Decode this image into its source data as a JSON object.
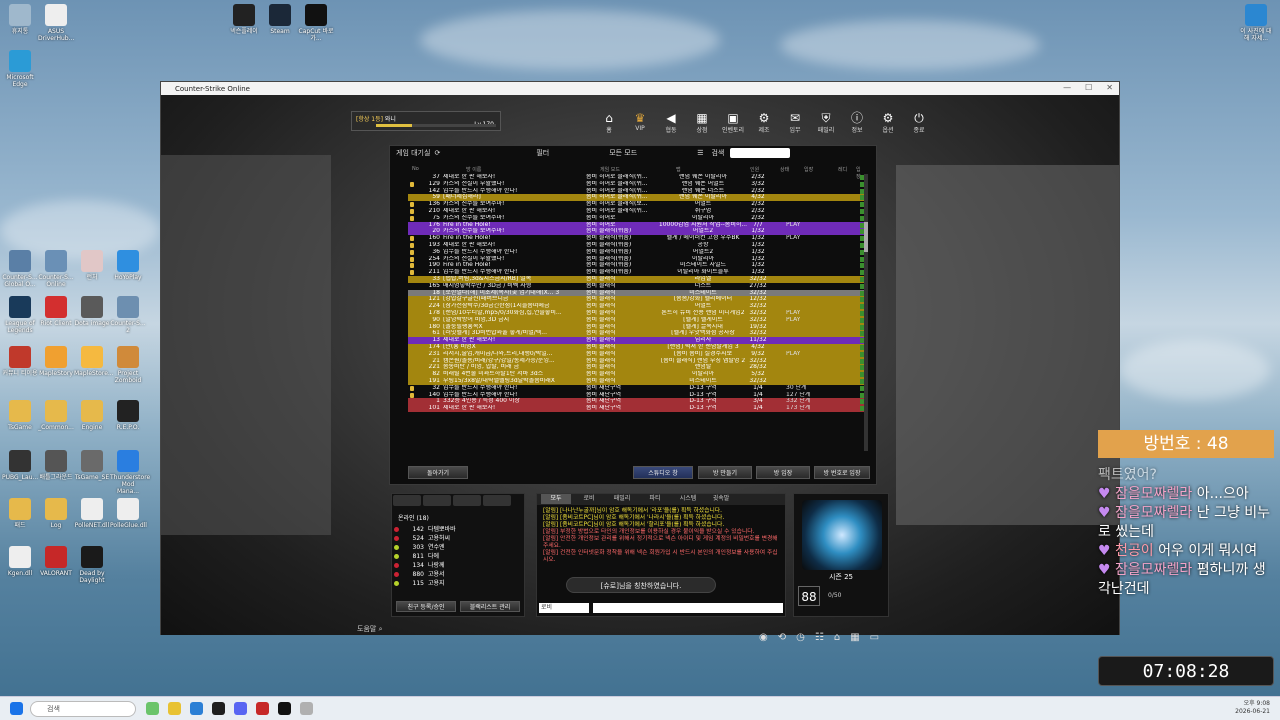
{
  "desktop": {
    "icons": [
      {
        "label": "휴지통"
      },
      {
        "label": "ASUS DriverHub..."
      },
      {
        "label": "Microsoft Edge"
      },
      {
        "label": "넥슨플레이"
      },
      {
        "label": "Steam"
      },
      {
        "label": "CapCut 바로가..."
      },
      {
        "label": "Counter-S... Global O..."
      },
      {
        "label": "Counter-S... Online"
      },
      {
        "label": "런처"
      },
      {
        "label": "HoYoPlay"
      },
      {
        "label": "League of Legends"
      },
      {
        "label": "Riot Client"
      },
      {
        "label": "Dota image"
      },
      {
        "label": "Counter-S... 2"
      },
      {
        "label": "커뮤니 티이용"
      },
      {
        "label": "MapleStory"
      },
      {
        "label": "MapleStore..."
      },
      {
        "label": "Project Zomboid"
      },
      {
        "label": "TsGame"
      },
      {
        "label": "_Common..."
      },
      {
        "label": "Engine"
      },
      {
        "label": "R.E.P.O."
      },
      {
        "label": "PUBG_Lau..."
      },
      {
        "label": "배틀그라운드"
      },
      {
        "label": "TsGame_SE"
      },
      {
        "label": "Thunderstore Mod Mana..."
      },
      {
        "label": "패드"
      },
      {
        "label": "Log"
      },
      {
        "label": "PolleNET.dll"
      },
      {
        "label": "PolleGlue.dll"
      },
      {
        "label": "Kgen.dll"
      },
      {
        "label": "VALORANT"
      },
      {
        "label": "Dead by Daylight"
      },
      {
        "label": "이 사진에 대해 자세..."
      }
    ]
  },
  "window": {
    "title": "Counter-Strike Online"
  },
  "profile": {
    "rank": "[항상 1등]",
    "name": "와니",
    "level": "Lv.170",
    "badge": "150"
  },
  "nav": [
    {
      "label": "홈",
      "icon": "home-icon"
    },
    {
      "label": "VIP",
      "icon": "crown-icon"
    },
    {
      "label": "협동",
      "icon": "megaphone-icon"
    },
    {
      "label": "상점",
      "icon": "shop-icon"
    },
    {
      "label": "인벤토리",
      "icon": "inventory-icon"
    },
    {
      "label": "제조",
      "icon": "craft-icon"
    },
    {
      "label": "임무",
      "icon": "mission-icon"
    },
    {
      "label": "패밀리",
      "icon": "family-icon"
    },
    {
      "label": "정보",
      "icon": "info-icon"
    },
    {
      "label": "옵션",
      "icon": "gear-icon"
    },
    {
      "label": "종료",
      "icon": "power-icon"
    }
  ],
  "room_list": {
    "header": "게임 대기실",
    "filter_label": "필터",
    "mode_label": "모든 모드",
    "search_label": "검색",
    "columns": [
      "No",
      "방 이름",
      "게임 모드",
      "맵",
      "인원",
      "상태",
      "입장",
      "레디",
      "입장"
    ],
    "rows": [
      {
        "no": "37",
        "title": "제대로 한 판 해보자!",
        "mode": "좀비 히어로 클래식(쉬...",
        "map": "랜덤 웨폰 이탈리아",
        "count": "2/32",
        "status": "",
        "style": "",
        "lock": false
      },
      {
        "no": "129",
        "title": "카스의 전설이 부활했다!",
        "mode": "좀비 히어로 클래식(쉬...",
        "map": "랜덤 웨폰 어벌트",
        "count": "3/32",
        "status": "",
        "style": "",
        "lock": true
      },
      {
        "no": "142",
        "title": "임무를 반드시 수행해야 한다!",
        "mode": "좀비 히어로 클래식(쉬...",
        "map": "랜덤 웨폰 더스트",
        "count": "2/32",
        "status": "",
        "style": "",
        "lock": false
      },
      {
        "no": "59",
        "title": "[패너제집해라]",
        "mode": "좀비 히어로 클래식(쉬...",
        "map": "랜덤 웨폰 이탈리아",
        "count": "4/32",
        "status": "",
        "style": "gold",
        "lock": false
      },
      {
        "no": "136",
        "title": "카스의 진수를 보여주마!",
        "mode": "좀비 히어로 클래식(보...",
        "map": "어벌트",
        "count": "2/32",
        "status": "",
        "style": "",
        "lock": true
      },
      {
        "no": "210",
        "title": "제대로 한 판 해보자!",
        "mode": "좀비 히어로 클래식(쉬...",
        "map": "쥐구멍",
        "count": "2/32",
        "status": "",
        "style": "",
        "lock": true
      },
      {
        "no": "75",
        "title": "카스의 진수를 보여주마!",
        "mode": "좀비 히어로",
        "map": "이탈리아",
        "count": "2/32",
        "status": "",
        "style": "",
        "lock": true
      },
      {
        "no": "176",
        "title": "Fire in the Hole!",
        "mode": "좀비 히어로",
        "map": "10000감염 지원처 작업--좀비히...",
        "count": "7/7",
        "status": "PLAY",
        "style": "purple",
        "lock": false
      },
      {
        "no": "20",
        "title": "카스의 진수를 보여주마!",
        "mode": "좀비 클래식(쉬움)",
        "map": "어벌트2",
        "count": "1/32",
        "status": "",
        "style": "purple",
        "lock": false
      },
      {
        "no": "160",
        "title": "Fire in the Hole!",
        "mode": "좀비 클래식(쉬움)",
        "map": "헬게 / 메이러컨 고정 우주BK",
        "count": "1/32",
        "status": "PLAY",
        "style": "",
        "lock": true
      },
      {
        "no": "193",
        "title": "제대로 한 판 해보자!",
        "mode": "좀비 클래식(쉬움)",
        "map": "공항",
        "count": "1/32",
        "status": "",
        "style": "",
        "lock": true
      },
      {
        "no": "36",
        "title": "임무를 반드시 수행해야 한다!",
        "mode": "좀비 클래식(쉬움)",
        "map": "어벌트2",
        "count": "1/32",
        "status": "",
        "style": "",
        "lock": true
      },
      {
        "no": "254",
        "title": "카스의 전설이 부활했다!",
        "mode": "좀비 클래식(쉬움)",
        "map": "이탈리아",
        "count": "1/32",
        "status": "",
        "style": "",
        "lock": true
      },
      {
        "no": "190",
        "title": "Fire in the Hole!",
        "mode": "좀비 클래식(쉬움)",
        "map": "미스테이트 자일드",
        "count": "1/32",
        "status": "",
        "style": "",
        "lock": true
      },
      {
        "no": "211",
        "title": "임무를 반드시 수행해야 한다!",
        "mode": "좀비 클래식(쉬움)",
        "map": "이탈리아 화이트블루",
        "count": "1/32",
        "status": "",
        "style": "",
        "lock": true
      },
      {
        "no": "33",
        "title": "[랩탑,버림,3d&치즈금지/RB] 일목",
        "mode": "좀비 클래식",
        "map": "라임엘",
        "count": "32/32",
        "status": "",
        "style": "gold",
        "lock": false
      },
      {
        "no": "165",
        "title": "매시멍넣박수만 / 3D금 / 비벡 사형",
        "mode": "좀비 클래식",
        "map": "더스트",
        "count": "27/32",
        "status": "",
        "style": "",
        "lock": false
      },
      {
        "no": "18",
        "title": "[로한멀타(해] 미초제(목사(곶 업기대해(X... 3",
        "mode": "좀비 클래식",
        "map": "미스테이트",
        "count": "32/32",
        "status": "",
        "style": "grey",
        "lock": false
      },
      {
        "no": "121",
        "title": "[강밥갈구글신(패버브디금",
        "mode": "좀비 클래식",
        "map": "[좀좀/강화] 헬리베이터",
        "count": "12/32",
        "status": "",
        "style": "gold",
        "lock": false
      },
      {
        "no": "224",
        "title": "[참가전참박수/3d금긴한점(1지늘좀떠메금",
        "mode": "좀비 클래식",
        "map": "어벌트",
        "count": "32/32",
        "status": "",
        "style": "gold",
        "lock": false
      },
      {
        "no": "178",
        "title": "[랜덤/10무티발,mp5/0/30화섬,섭,연솔좋비...",
        "mode": "좀비 클래식",
        "map": "론트히 뉴비 전용 랜덤 미니게임2",
        "count": "32/32",
        "status": "PLAY",
        "style": "gold",
        "lock": false
      },
      {
        "no": "90",
        "title": "[발덩박방어 비명,3D 금지",
        "mode": "좀비 클래식",
        "map": "[헬게] 헬게이트",
        "count": "32/32",
        "status": "PLAY",
        "style": "gold",
        "lock": false
      },
      {
        "no": "180",
        "title": "[놀룽힐팽흥목X",
        "mode": "좀비 클래식",
        "map": "[헬게] 끌목시대",
        "count": "19/32",
        "status": "",
        "style": "gold",
        "lock": false
      },
      {
        "no": "61",
        "title": "[러잇헬게] 3D비번밥꽈울 좋게/비벌/텍...",
        "mode": "좀비 클래식",
        "map": "[헬게] 우앗백화점 공사장",
        "count": "32/32",
        "status": "",
        "style": "gold",
        "lock": false
      },
      {
        "no": "13",
        "title": "제대로 한 판 해보자!",
        "mode": "좀비 클래식",
        "map": "딥리사",
        "count": "11/32",
        "status": "",
        "style": "purple",
        "lock": false
      },
      {
        "no": "174",
        "title": "[만(흥 비명X",
        "mode": "좀비 클래식",
        "map": "[랜덤] 럭셔 한 랜덤탈게임 3",
        "count": "4/32",
        "status": "",
        "style": "gold",
        "lock": false
      },
      {
        "no": "231",
        "title": "리저치,술업,캐미급/나와,트리,대행0/박일...",
        "mode": "좀비 클래식",
        "map": "[좀비 좀비] 설경주지보",
        "count": "9/32",
        "status": "PLAY",
        "style": "gold",
        "lock": false
      },
      {
        "no": "21",
        "title": "캠손원/놀용/비래/강구/강밀/통제가능/운잉...",
        "mode": "좀비 클래식",
        "map": "[좀비 클래식] 랜덤 부칭 맵탈명 2",
        "count": "32/32",
        "status": "",
        "style": "gold",
        "lock": false
      },
      {
        "no": "221",
        "title": "좀통비탄 / 비명, 밥탈, 비래 금",
        "mode": "좀비 클래식",
        "map": "랜덤탈",
        "count": "28/32",
        "status": "",
        "style": "gold",
        "lock": false
      },
      {
        "no": "82",
        "title": "비래릴 4번출 미꽈트하탈1탄 서바 3d스",
        "mode": "좀비 클래식",
        "map": "이탈리아",
        "count": "5/32",
        "status": "",
        "style": "gold",
        "lock": false
      },
      {
        "no": "191",
        "title": "부링15/3x8발/대략밸헬링3d달박놀좀비래X",
        "mode": "좀비 클래식",
        "map": "미스테이트",
        "count": "32/32",
        "status": "",
        "style": "gold",
        "lock": false
      },
      {
        "no": "32",
        "title": "임무를 반드시 수행해야 한다!",
        "mode": "좀비 재난구역",
        "map": "D-13 구역",
        "count": "1/4",
        "status": "30 단계",
        "style": "",
        "lock": true
      },
      {
        "no": "140",
        "title": "임무를 반드시 수행해야 한다!",
        "mode": "좀비 재난구역",
        "map": "D-13 구역",
        "count": "1/4",
        "status": "127 단계",
        "style": "",
        "lock": true
      },
      {
        "no": "1",
        "title": "332층 4인용 / 특성 400 이상",
        "mode": "좀비 재난구역",
        "map": "D-13 구역",
        "count": "3/4",
        "status": "332 단계",
        "style": "red",
        "lock": false
      },
      {
        "no": "101",
        "title": "제대로 한 판 해보자!",
        "mode": "좀비 재난구역",
        "map": "D-13 구역",
        "count": "1/4",
        "status": "173 단계",
        "style": "red",
        "lock": false
      }
    ],
    "buttons": {
      "back": "돌아가기",
      "studio": "스튜디오 창",
      "create": "방 만들기",
      "enter": "방 입장",
      "enter_num": "방 번호로 입장"
    }
  },
  "friends": {
    "online_label": "온라인 (18)",
    "list": [
      {
        "level": "142",
        "name": "다템뽀바바"
      },
      {
        "level": "524",
        "name": "고용허씨"
      },
      {
        "level": "303",
        "name": "연수엔"
      },
      {
        "level": "811",
        "name": "다에"
      },
      {
        "level": "134",
        "name": "나랑께"
      },
      {
        "level": "880",
        "name": "고용서"
      },
      {
        "level": "115",
        "name": "고용지"
      }
    ],
    "add_button": "친구 등록/승인",
    "blacklist_button": "블랙리스트 관리"
  },
  "chat": {
    "tabs": [
      "모두",
      "로비",
      "패밀리",
      "파티",
      "시스템",
      "귓속말"
    ],
    "lines": [
      "[알림] [나나난누굴까]님이 암호 해독기에서 '라포'을(를) 획득 하셨습니다.",
      "[알림] [좀비코트PC]님이 암호 해독기에서 '나라시'을(를) 획득 하셨습니다.",
      "[알림] [좀비코트PC]님이 암호 해독기에서 '할리포'을(를) 획득 하셨습니다.",
      "[알림] 부정한 방법으로 타인의 개인정보를 이용하실 경우 불이익을 받으실 수 있습니다.",
      "[알림] 안전한 개인정보 관리를 위해서 정기적으로 넥슨 아이디 및 게임 계정의 비밀번호를 변경해 주세요.",
      "[알림] 건전한 인터넷문화 정착을 위해 넥슨 회원가입 시 반드시 본인의 개인정보를 사용하여 주십시오."
    ],
    "input_channel": "로비",
    "toast": "[슈로]님을 칭찬하였습니다."
  },
  "season": {
    "label": "시즌 25",
    "rank": "88",
    "progress": "0/50"
  },
  "bottom_help": "도움말",
  "overlay": {
    "room_number": "방번호 : 48",
    "messages": [
      {
        "nick": "",
        "text": "팩트였어?"
      },
      {
        "nick": "잠을모짜렐라",
        "text": "아...으아"
      },
      {
        "nick": "잠을모짜렐라",
        "text": "난 그냥 비누로 씼는데"
      },
      {
        "nick": "천공이",
        "text": "어우 이게 뭐시여"
      },
      {
        "nick": "잠을모짜렐라",
        "text": "폄하니까 생각난건데"
      }
    ],
    "clock": "07:08:28"
  },
  "taskbar": {
    "search_placeholder": "검색",
    "tray_time": "오후 9:08",
    "tray_date": "2026-06-21"
  }
}
